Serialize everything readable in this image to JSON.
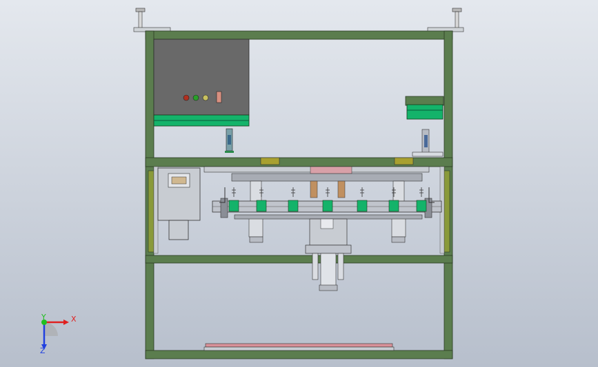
{
  "colors": {
    "background_top": "#e4e8ee",
    "background_bottom": "#b7bfcc",
    "frame": "#5b7d4e",
    "frame_edge": "#2a3a24",
    "panel": "#696969",
    "accent_green": "#14b36a",
    "rail": "#c0c4cc",
    "axis_x": "#e02020",
    "axis_y": "#20c020",
    "axis_z": "#2040e0",
    "light_red": "#b03020",
    "light_green": "#2aa02a",
    "light_yellow": "#c8c060"
  },
  "control_panel": {
    "indicator_lights": [
      "red-light",
      "green-light",
      "yellow-light"
    ]
  },
  "triad": {
    "x_label": "X",
    "y_label": "Y",
    "z_label": "Z"
  }
}
